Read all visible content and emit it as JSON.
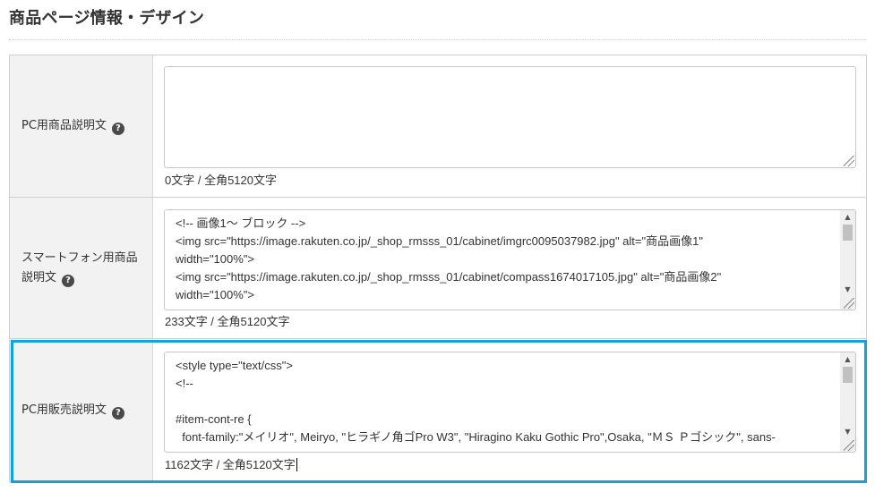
{
  "section": {
    "title": "商品ページ情報・デザイン"
  },
  "help_glyph": "?",
  "rows": [
    {
      "label": "PC用商品説明文",
      "content": "",
      "count": "0文字 / 全角5120文字"
    },
    {
      "label": "スマートフォン用商品説明文",
      "content": "<!-- 画像1～ ブロック -->\n<img src=\"https://image.rakuten.co.jp/_shop_rmsss_01/cabinet/imgrc0095037982.jpg\" alt=\"商品画像1\"\nwidth=\"100%\">\n<img src=\"https://image.rakuten.co.jp/_shop_rmsss_01/cabinet/compass1674017105.jpg\" alt=\"商品画像2\"\nwidth=\"100%\">",
      "count": "233文字 / 全角5120文字"
    },
    {
      "label": "PC用販売説明文",
      "content": "<style type=\"text/css\">\n<!--\n\n#item-cont-re {\n  font-family:\"メイリオ\", Meiryo, \"ヒラギノ角ゴPro W3\", \"Hiragino Kaku Gothic Pro\",Osaka, \"ＭＳ Ｐゴシック\", sans-",
      "count": "1162文字 / 全角5120文字"
    }
  ],
  "colors": {
    "highlight": "#10a3dd",
    "label_bg": "#f2f2f2"
  }
}
